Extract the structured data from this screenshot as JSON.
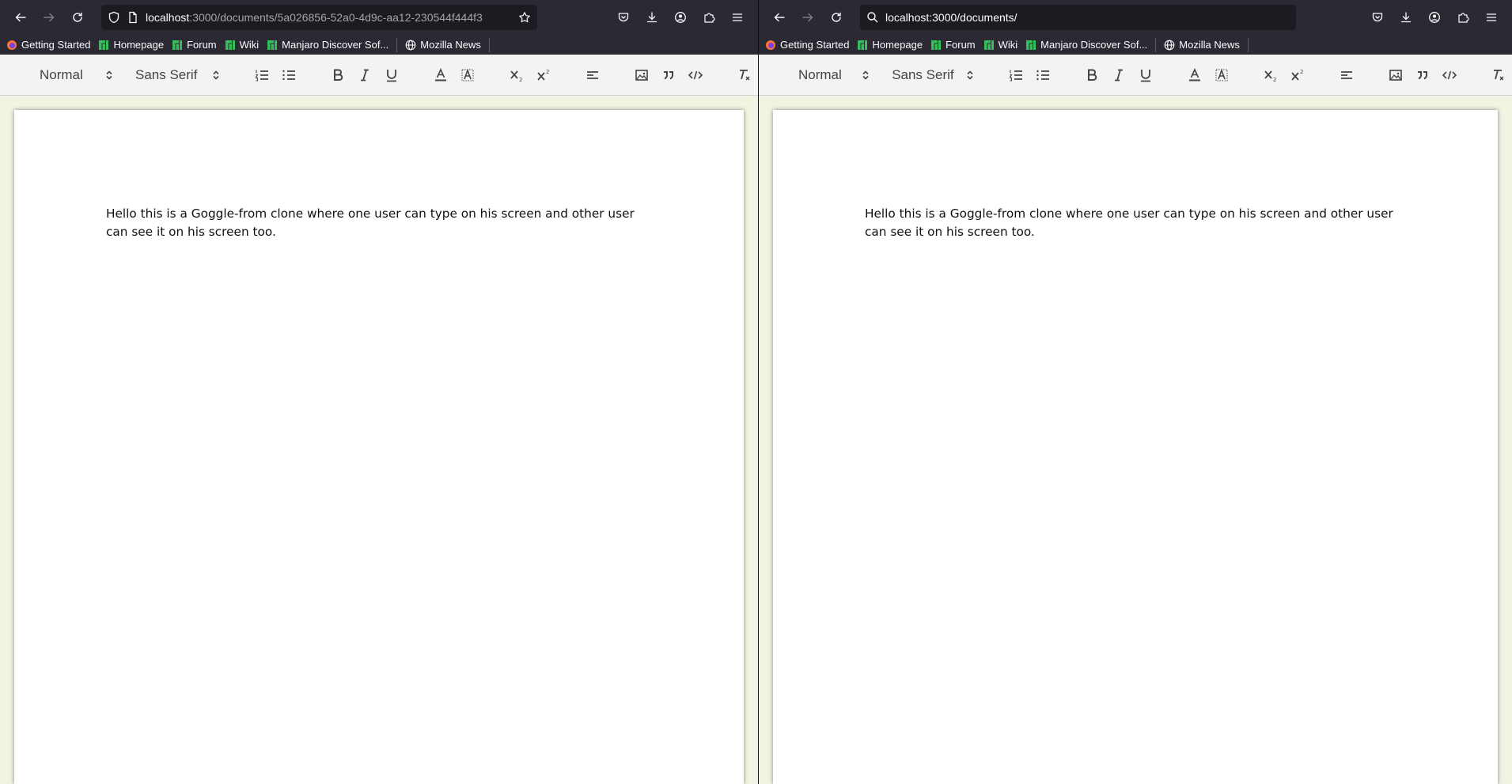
{
  "left_window": {
    "url_host": "localhost",
    "url_path": ":3000/documents/5a026856-52a0-4d9c-aa12-230544f444f3"
  },
  "right_window": {
    "url": "localhost:3000/documents/"
  },
  "bookmarks": [
    {
      "label": "Getting Started",
      "icon": "firefox-icon"
    },
    {
      "label": "Homepage",
      "icon": "manjaro-icon"
    },
    {
      "label": "Forum",
      "icon": "manjaro-icon"
    },
    {
      "label": "Wiki",
      "icon": "manjaro-icon"
    },
    {
      "label": "Manjaro Discover Sof...",
      "icon": "manjaro-icon"
    },
    {
      "label": "Mozilla News",
      "icon": "globe-icon"
    }
  ],
  "toolbar": {
    "header_value": "Normal",
    "font_value": "Sans Serif"
  },
  "document": {
    "text": "Hello this is a Goggle-from clone where one user can type on his screen and other user can see it on his screen too."
  },
  "colors": {
    "chrome": "#2b2a33",
    "urlbar": "#1c1b22",
    "toolbar": "#f3f3f3",
    "doc_bg": "#f3f3e3",
    "manjaro_green": "#35bf5c"
  }
}
